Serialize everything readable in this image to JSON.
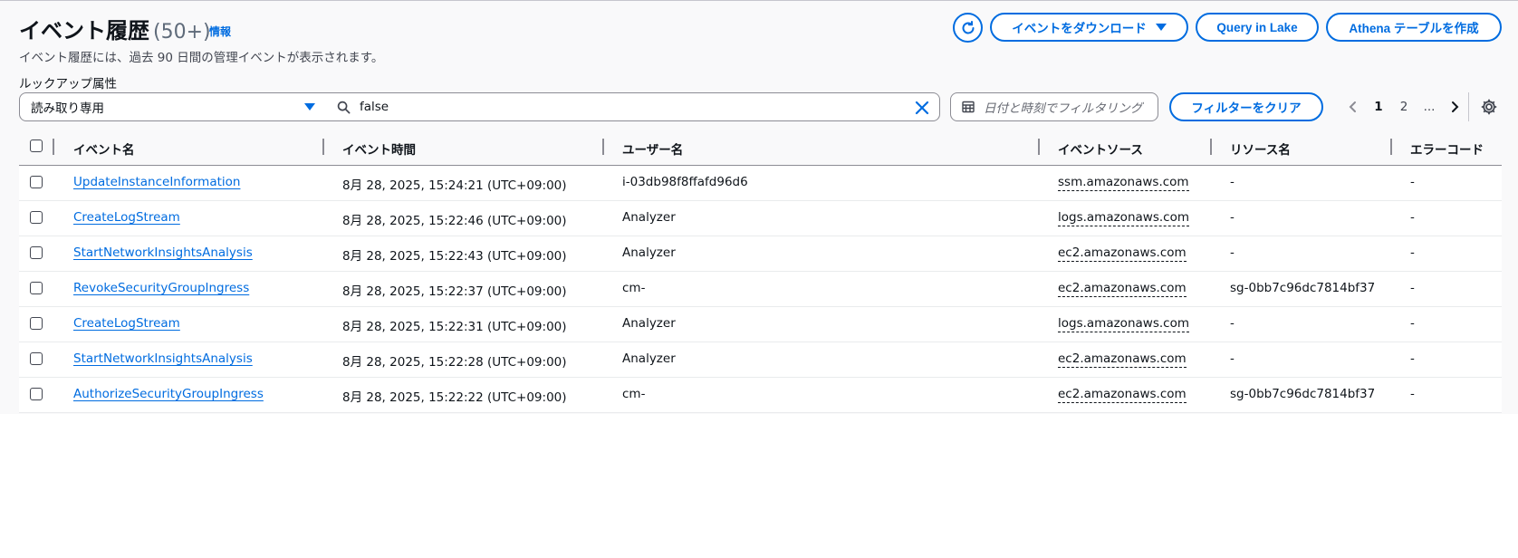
{
  "header": {
    "title": "イベント履歴",
    "count": "(50+)",
    "info_link": "情報",
    "subtitle": "イベント履歴には、過去 90 日間の管理イベントが表示されます。"
  },
  "actions": {
    "download_label": "イベントをダウンロード",
    "query_lake_label": "Query in Lake",
    "athena_label": "Athena テーブルを作成"
  },
  "filters": {
    "lookup_label": "ルックアップ属性",
    "attribute_selected": "読み取り専用",
    "search_value": "false",
    "date_placeholder": "日付と時刻でフィルタリング",
    "clear_filters_label": "フィルターをクリア"
  },
  "pagination": {
    "pages": [
      "1",
      "2",
      "..."
    ],
    "current": "1"
  },
  "table": {
    "columns": [
      "イベント名",
      "イベント時間",
      "ユーザー名",
      "イベントソース",
      "リソース名",
      "エラーコード"
    ],
    "rows": [
      {
        "event_name": "UpdateInstanceInformation",
        "event_time": "8月 28, 2025, 15:24:21 (UTC+09:00)",
        "user_name": "i-03db98f8ffafd96d6",
        "event_source": "ssm.amazonaws.com",
        "resource_name": "-",
        "error_code": "-"
      },
      {
        "event_name": "CreateLogStream",
        "event_time": "8月 28, 2025, 15:22:46 (UTC+09:00)",
        "user_name": "Analyzer",
        "event_source": "logs.amazonaws.com",
        "resource_name": "-",
        "error_code": "-"
      },
      {
        "event_name": "StartNetworkInsightsAnalysis",
        "event_time": "8月 28, 2025, 15:22:43 (UTC+09:00)",
        "user_name": "Analyzer",
        "event_source": "ec2.amazonaws.com",
        "resource_name": "-",
        "error_code": "-"
      },
      {
        "event_name": "RevokeSecurityGroupIngress",
        "event_time": "8月 28, 2025, 15:22:37 (UTC+09:00)",
        "user_name": "cm-",
        "event_source": "ec2.amazonaws.com",
        "resource_name": "sg-0bb7c96dc7814bf37",
        "error_code": "-"
      },
      {
        "event_name": "CreateLogStream",
        "event_time": "8月 28, 2025, 15:22:31 (UTC+09:00)",
        "user_name": "Analyzer",
        "event_source": "logs.amazonaws.com",
        "resource_name": "-",
        "error_code": "-"
      },
      {
        "event_name": "StartNetworkInsightsAnalysis",
        "event_time": "8月 28, 2025, 15:22:28 (UTC+09:00)",
        "user_name": "Analyzer",
        "event_source": "ec2.amazonaws.com",
        "resource_name": "-",
        "error_code": "-"
      },
      {
        "event_name": "AuthorizeSecurityGroupIngress",
        "event_time": "8月 28, 2025, 15:22:22 (UTC+09:00)",
        "user_name": "cm-",
        "event_source": "ec2.amazonaws.com",
        "resource_name": "sg-0bb7c96dc7814bf37",
        "error_code": "-"
      }
    ]
  },
  "icons": {
    "refresh": "refresh-icon",
    "search": "search-icon",
    "clear": "close-icon",
    "calendar": "calendar-icon",
    "prev": "chevron-left-icon",
    "next": "chevron-right-icon",
    "settings": "gear-icon"
  },
  "colors": {
    "accent": "#006ce0",
    "text": "#0f141a",
    "muted": "#5f6b7a"
  }
}
